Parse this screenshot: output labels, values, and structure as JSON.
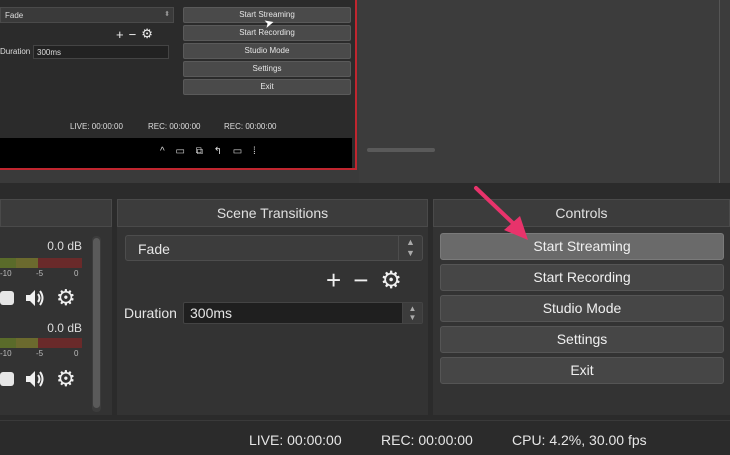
{
  "preview": {
    "transition_value": "Fade",
    "duration_label": "Duration",
    "duration_value": "300ms",
    "buttons": [
      "Start Streaming",
      "Start Recording",
      "Studio Mode",
      "Settings",
      "Exit"
    ],
    "status": {
      "live": "LIVE: 00:00:00",
      "rec": "REC: 00:00:00",
      "rec2": "REC: 00:00:00"
    }
  },
  "mixer": {
    "channels": [
      {
        "db": "0.0 dB",
        "ticks": [
          "-10",
          "-5",
          "0"
        ]
      },
      {
        "db": "0.0 dB",
        "ticks": [
          "-10",
          "-5",
          "0"
        ]
      }
    ]
  },
  "transitions": {
    "header": "Scene Transitions",
    "selected": "Fade",
    "duration_label": "Duration",
    "duration_value": "300ms"
  },
  "controls": {
    "header": "Controls",
    "buttons": {
      "start_streaming": "Start Streaming",
      "start_recording": "Start Recording",
      "studio_mode": "Studio Mode",
      "settings": "Settings",
      "exit": "Exit"
    }
  },
  "statusbar": {
    "live": "LIVE: 00:00:00",
    "rec": "REC: 00:00:00",
    "cpu": "CPU: 4.2%, 30.00 fps"
  },
  "colors": {
    "preview_border": "#c0262f",
    "annotation_arrow": "#e8336b",
    "background": "#2b2b2b"
  },
  "icons": [
    "plus-icon",
    "minus-icon",
    "gear-icon",
    "speaker-icon",
    "cursor-icon"
  ]
}
